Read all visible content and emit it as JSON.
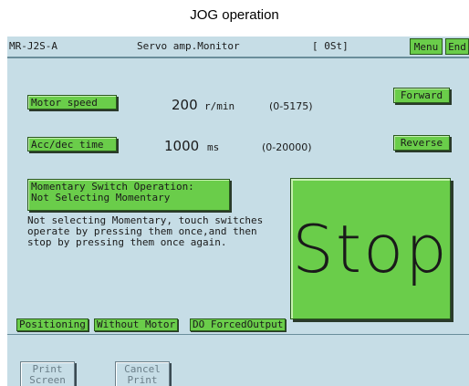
{
  "page_title": "JOG operation",
  "titlebar": {
    "model": "MR-J2S-A",
    "screen_name": "Servo amp.Monitor",
    "station": "[ 0St]",
    "menu_label": "Menu",
    "end_label": "End"
  },
  "motor_speed": {
    "label": "Motor speed",
    "value": "200",
    "unit": "r/min",
    "range": "(0-5175)"
  },
  "acc_dec": {
    "label": "Acc/dec time",
    "value": "1000",
    "unit": "ms",
    "range": "(0-20000)"
  },
  "forward_label": "Forward",
  "reverse_label": "Reverse",
  "momentary": {
    "line1": "Momentary Switch Operation:",
    "line2": "Not Selecting Momentary"
  },
  "description": {
    "line1": "Not selecting Momentary, touch switches",
    "line2": "operate by pressing them once,and then",
    "line3": "stop by pressing them once again."
  },
  "stop_label": "Stop",
  "tabs": {
    "positioning": "Positioning",
    "without_motor": "Without Motor",
    "do_forced": "DO ForcedOutput"
  },
  "print_screen": {
    "line1": "Print",
    "line2": "Screen"
  },
  "cancel_print": {
    "line1": "Cancel",
    "line2": "Print"
  },
  "colors": {
    "screen_bg": "#c6dde6",
    "button_green": "#6acd4a",
    "disabled_text": "#6a7e88"
  }
}
